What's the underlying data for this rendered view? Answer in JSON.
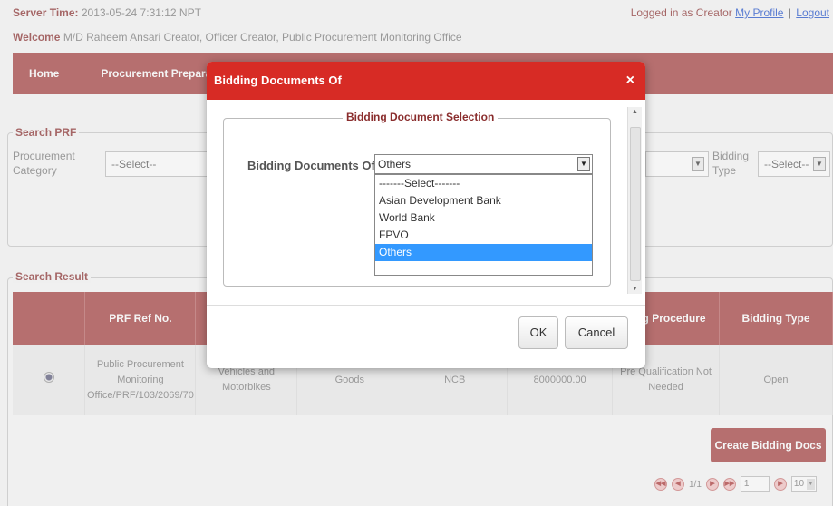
{
  "topbar": {
    "server_time_label": "Server Time:",
    "server_time_value": "2013-05-24 7:31:12 NPT",
    "logged_in_label": "Logged in as",
    "user": "Creator",
    "my_profile": "My Profile",
    "separator": "|",
    "logout": "Logout"
  },
  "welcome": {
    "label": "Welcome",
    "text": "M/D Raheem Ansari Creator, Officer Creator, Public Procurement Monitoring Office"
  },
  "nav": {
    "items": [
      "Home",
      "Procurement Preparati"
    ]
  },
  "search": {
    "legend": "Search PRF",
    "procurement_category_label": "Procurement Category",
    "procurement_category_value": "--Select--",
    "bidding_type_label": "Bidding Type",
    "bidding_type_value": "--Select--"
  },
  "result": {
    "legend": "Search Result",
    "columns": [
      "",
      "PRF Ref No.",
      "",
      "",
      "",
      "",
      "ding Procedure",
      "Bidding Type"
    ],
    "rows": [
      [
        "",
        "Public Procurement Monitoring Office/PRF/103/2069/70",
        "Vehicles and Motorbikes",
        "Goods",
        "NCB",
        "8000000.00",
        "Pre Qualification Not Needed",
        "Open"
      ]
    ],
    "create_button": "Create Bidding Docs"
  },
  "pager": {
    "page_info": "1/1",
    "page_value": "1",
    "page_size": "10"
  },
  "modal": {
    "title": "Bidding Documents Of",
    "close": "×",
    "section_legend": "Bidding Document Selection",
    "field_label": "Bidding Documents Of",
    "selected_value": "Others",
    "options": [
      "-------Select-------",
      "Asian Development Bank",
      "World Bank",
      "FPVO",
      "Others"
    ],
    "ok_label": "OK",
    "cancel_label": "Cancel"
  }
}
